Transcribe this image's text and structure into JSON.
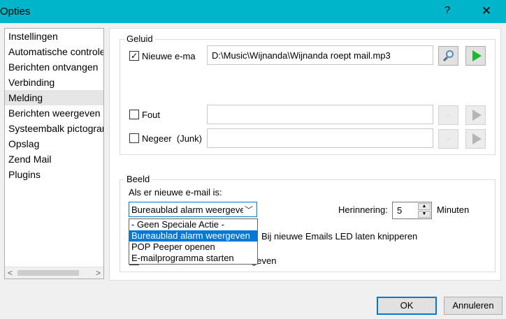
{
  "window": {
    "title": "Opties",
    "help_label": "?",
    "close_label": "✕"
  },
  "sidebar": {
    "items": [
      {
        "label": "Instellingen"
      },
      {
        "label": "Automatische controle"
      },
      {
        "label": "Berichten ontvangen"
      },
      {
        "label": "Verbinding"
      },
      {
        "label": "Melding",
        "selected": true
      },
      {
        "label": "Berichten weergeven"
      },
      {
        "label": "Systeembalk pictogram"
      },
      {
        "label": "Opslag"
      },
      {
        "label": "Zend Mail"
      },
      {
        "label": "Plugins"
      }
    ],
    "scroll_left": "<",
    "scroll_right": ">"
  },
  "geluid": {
    "legend": "Geluid",
    "rows": [
      {
        "label": "Nieuwe e-ma",
        "checked": true,
        "path": "D:\\Music\\Wijnanda\\Wijnanda roept mail.mp3",
        "enabled": true
      },
      {
        "label": "Fout",
        "checked": false,
        "path": "",
        "enabled": false
      },
      {
        "label": "Negeer  (Junk)",
        "checked": false,
        "path": "",
        "enabled": false
      }
    ],
    "check_mark": "✓",
    "browse_icon": "magnifier-icon",
    "play_icon": "play-icon",
    "browse_disabled_label": "..."
  },
  "beeld": {
    "legend": "Beeld",
    "prompt": "Als er nieuwe e-mail is:",
    "select_value": "Bureaublad alarm weergeven",
    "select_chevron": "﹀",
    "dropdown_options": [
      {
        "label": "- Geen Speciale Actie -"
      },
      {
        "label": "Bureaublad alarm weergeven",
        "selected": true
      },
      {
        "label": "POP Peeper openen"
      },
      {
        "label": "E-mailprogramma starten"
      }
    ],
    "reminder_label": "Herinnering:",
    "reminder_value": "5",
    "reminder_unit": "Minuten",
    "spin_up": "▲",
    "spin_down": "▼",
    "led_label": "Bij nieuwe Emails LED laten knipperen",
    "partial_label": "geven"
  },
  "buttons": {
    "ok": "OK",
    "cancel": "Annuleren"
  },
  "colors": {
    "titlebar": "#00b4c9",
    "accent": "#0078d7",
    "play": "#1bb72e"
  }
}
